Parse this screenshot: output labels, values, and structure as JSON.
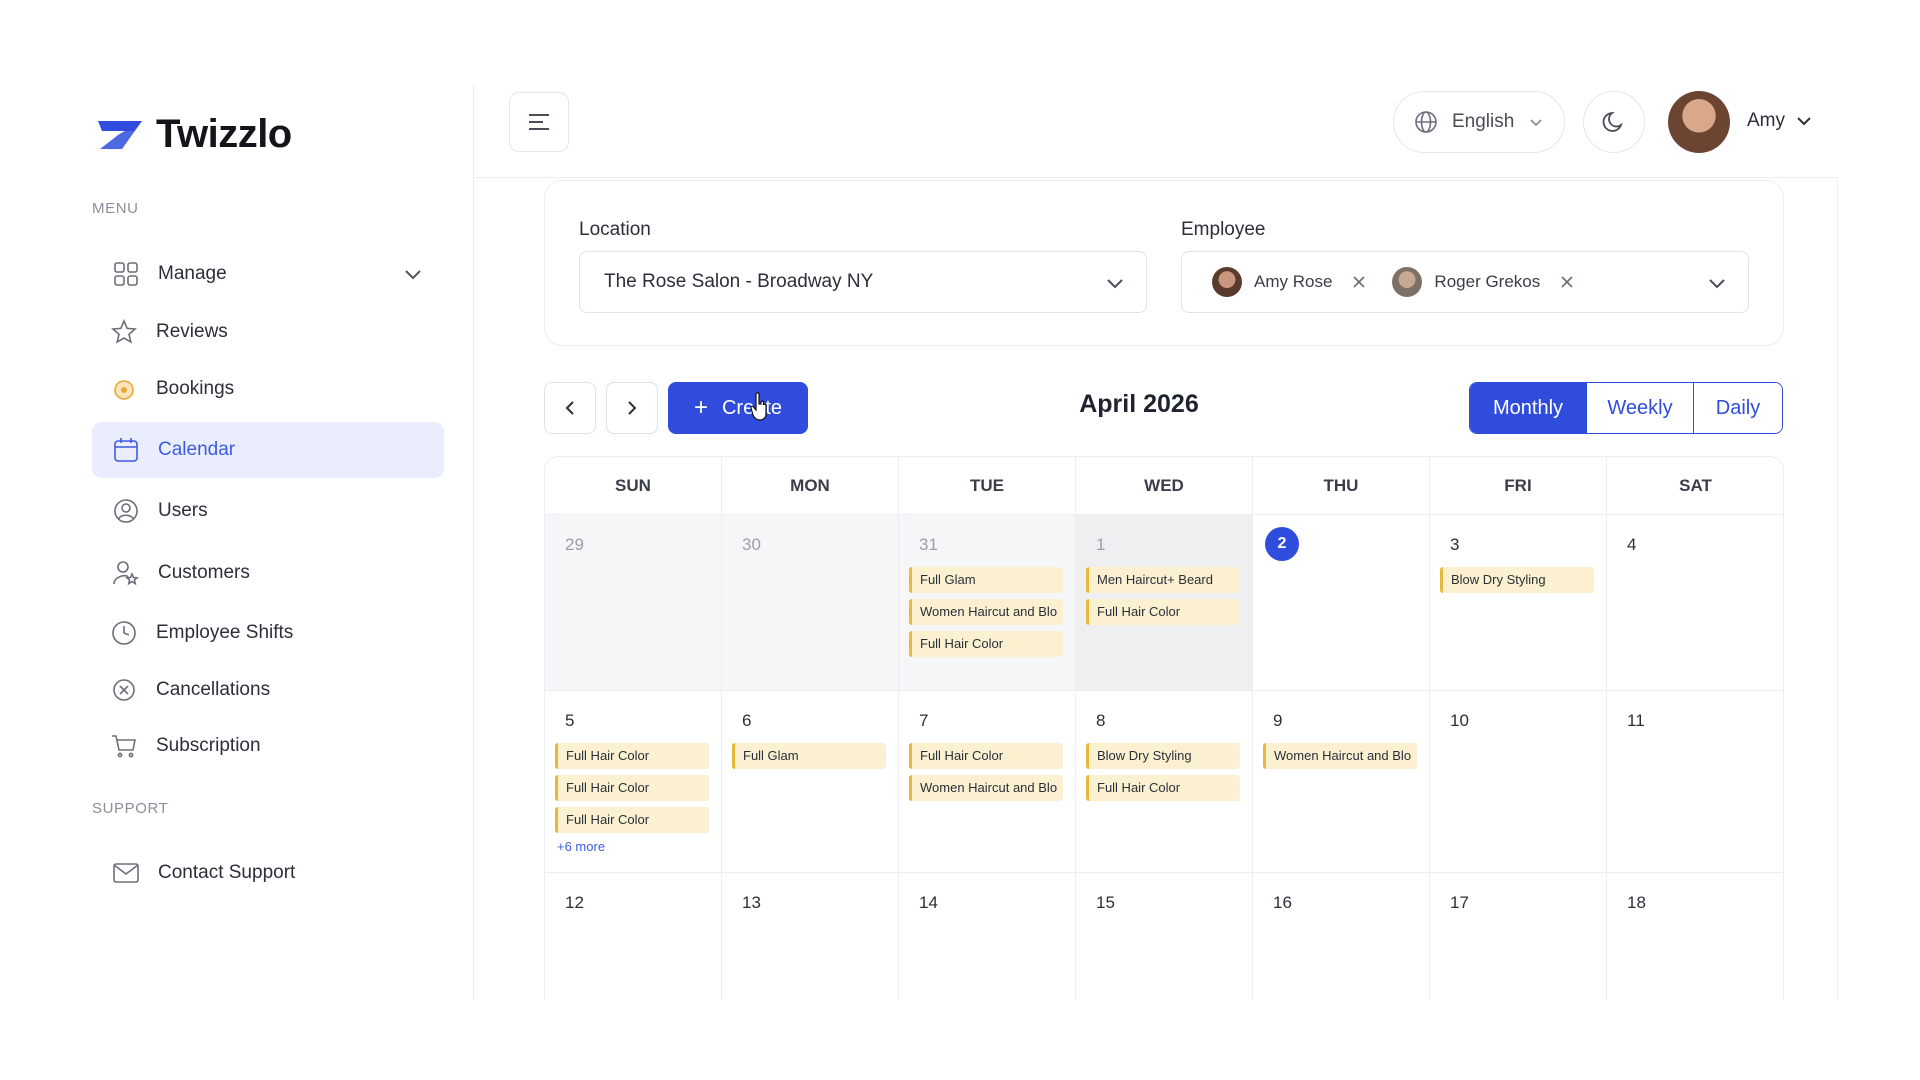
{
  "app": {
    "name": "Twizzlo",
    "accent": "#2f4cdd"
  },
  "sidebar": {
    "menu_label": "MENU",
    "support_label": "SUPPORT",
    "items": [
      {
        "label": "Manage",
        "icon": "grid-icon"
      },
      {
        "label": "Reviews",
        "icon": "star-icon"
      },
      {
        "label": "Bookings",
        "icon": "bookings-icon"
      },
      {
        "label": "Calendar",
        "icon": "calendar-icon",
        "active": true
      },
      {
        "label": "Users",
        "icon": "user-circle-icon"
      },
      {
        "label": "Customers",
        "icon": "customer-star-icon"
      },
      {
        "label": "Employee Shifts",
        "icon": "clock-icon"
      },
      {
        "label": "Cancellations",
        "icon": "x-circle-icon"
      },
      {
        "label": "Subscription",
        "icon": "cart-icon"
      }
    ],
    "support_items": [
      {
        "label": "Contact Support",
        "icon": "mail-icon"
      }
    ]
  },
  "header": {
    "language": "English",
    "user": "Amy"
  },
  "filters": {
    "location_label": "Location",
    "location_value": "The Rose Salon - Broadway NY",
    "employee_label": "Employee",
    "employees": [
      "Amy Rose",
      "Roger Grekos"
    ]
  },
  "toolbar": {
    "create_label": "Create",
    "month_title": "April 2026",
    "views": [
      "Monthly",
      "Weekly",
      "Daily"
    ],
    "active_view": "Monthly"
  },
  "calendar": {
    "weekdays": [
      "SUN",
      "MON",
      "TUE",
      "WED",
      "THU",
      "FRI",
      "SAT"
    ],
    "weeks": [
      [
        {
          "day": "29",
          "muted": true,
          "events": []
        },
        {
          "day": "30",
          "muted": true,
          "events": []
        },
        {
          "day": "31",
          "muted": true,
          "events": [
            "Full Glam",
            "Women Haircut and Blo",
            "Full Hair Color"
          ]
        },
        {
          "day": "1",
          "muted": true,
          "dark": true,
          "events": [
            "Men Haircut+ Beard",
            "Full Hair Color"
          ]
        },
        {
          "day": "2",
          "today": true,
          "events": []
        },
        {
          "day": "3",
          "events": [
            "Blow Dry Styling"
          ]
        },
        {
          "day": "4",
          "events": []
        }
      ],
      [
        {
          "day": "5",
          "events": [
            "Full Hair Color",
            "Full Hair Color",
            "Full Hair Color"
          ],
          "more": "+6 more"
        },
        {
          "day": "6",
          "events": [
            "Full Glam"
          ]
        },
        {
          "day": "7",
          "events": [
            "Full Hair Color",
            "Women Haircut and Blo"
          ]
        },
        {
          "day": "8",
          "events": [
            "Blow Dry Styling",
            "Full Hair Color"
          ]
        },
        {
          "day": "9",
          "events": [
            "Women Haircut and Blo"
          ]
        },
        {
          "day": "10",
          "events": []
        },
        {
          "day": "11",
          "events": []
        }
      ],
      [
        {
          "day": "12",
          "events": []
        },
        {
          "day": "13",
          "events": []
        },
        {
          "day": "14",
          "events": []
        },
        {
          "day": "15",
          "events": []
        },
        {
          "day": "16",
          "events": []
        },
        {
          "day": "17",
          "events": []
        },
        {
          "day": "18",
          "events": []
        }
      ]
    ]
  }
}
